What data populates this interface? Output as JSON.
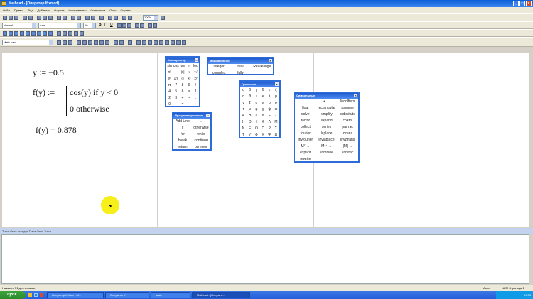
{
  "window": {
    "title": "Mathcad - [Оператор If.xmcd]"
  },
  "menu": [
    "Файл",
    "Правка",
    "Вид",
    "Добавить",
    "Формат",
    "Инструменты",
    "Символика",
    "Окно",
    "Справка"
  ],
  "toolbar": {
    "zoom": "100%",
    "style_combo": "Normal",
    "font_combo": "Arial",
    "size_combo": "10",
    "bold": "B",
    "italic": "I",
    "underline": "U",
    "region_combo": "Math calc"
  },
  "worksheet": {
    "line1": "y := −0.5",
    "func_lhs": "f(y) :=",
    "case1": "cos(y)   if   y < 0",
    "case2": "0   otherwise",
    "result": "f(y) = 0.878",
    "dot": "."
  },
  "palettes": {
    "calculator": {
      "title": "Калькулятор",
      "items": [
        "sin",
        "cos",
        "tan",
        "ln",
        "log",
        "n!",
        "i",
        "|x|",
        "√",
        "ⁿ√",
        "eˣ",
        "1/x",
        "()",
        "x²",
        "xʸ",
        "π",
        "7",
        "8",
        "9",
        "/",
        "4",
        "5",
        "6",
        "×",
        "1",
        "2",
        "3",
        "+",
        ":=",
        ".",
        "0",
        "−",
        "="
      ]
    },
    "modifiers": {
      "title": "Модификатор",
      "items": [
        "integer",
        "real",
        "RealRange",
        "complex",
        "fully"
      ]
    },
    "programming": {
      "title": "Программирование",
      "items": [
        "Add Line",
        "←",
        "if",
        "otherwise",
        "for",
        "while",
        "break",
        "continue",
        "return",
        "on error"
      ]
    },
    "greek": {
      "title": "Греческие",
      "items": [
        "α",
        "β",
        "γ",
        "δ",
        "ε",
        "ζ",
        "η",
        "θ",
        "ι",
        "κ",
        "λ",
        "μ",
        "ν",
        "ξ",
        "ο",
        "π",
        "ρ",
        "σ",
        "τ",
        "υ",
        "φ",
        "χ",
        "ψ",
        "ω",
        "Α",
        "Β",
        "Γ",
        "Δ",
        "Ε",
        "Ζ",
        "Η",
        "Θ",
        "Ι",
        "Κ",
        "Λ",
        "Μ",
        "Ν",
        "Ξ",
        "Ο",
        "Π",
        "Ρ",
        "Σ",
        "Τ",
        "Υ",
        "Φ",
        "Χ",
        "Ψ",
        "Ω"
      ]
    },
    "symbolic": {
      "title": "Символьные",
      "modifiers": "Modifiers",
      "items": [
        "→",
        "• →",
        "Modifiers",
        "float",
        "rectangular",
        "assume",
        "solve",
        "simplify",
        "substitute",
        "factor",
        "expand",
        "coeffs",
        "collect",
        "series",
        "parfrac",
        "fourier",
        "laplace",
        "ztrans",
        "invfourier",
        "invlaplace",
        "invztrans",
        "Mᵀ →",
        "M⁻¹ →",
        "|M| →",
        "explicit",
        "combine",
        "confrac",
        "rewrite"
      ]
    }
  },
  "bottom_tabs": "Trace Окно отладки   Trace   Окно Trace",
  "status": {
    "left": "Нажмите F1 для справки",
    "mode": "Авто",
    "nums": "NUM  Страница 1"
  },
  "taskbar": {
    "start": "пуск",
    "buttons": [
      "Оператор If.docx - M...",
      "Оператор If",
      "scan",
      "Mathcad - [Операто..."
    ],
    "clock": "19:53"
  }
}
